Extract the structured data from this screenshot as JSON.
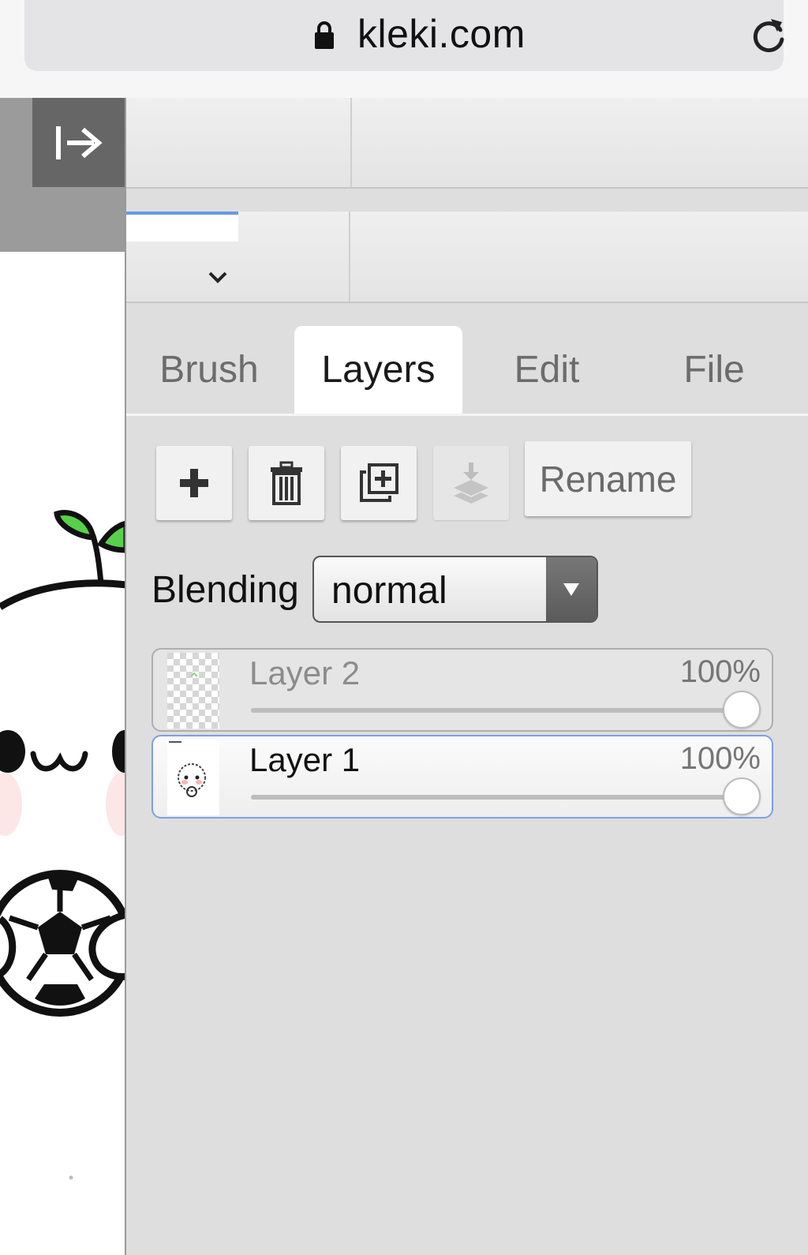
{
  "browser": {
    "url": "kleki.com",
    "lock_icon": "lock-icon",
    "reload_icon": "reload-icon"
  },
  "canvas": {
    "collapse_icon": "collapse-panel-icon"
  },
  "toolbar": {
    "chevron_icon": "chevron-down-icon",
    "accent_color": "#6a97e6"
  },
  "tabs": [
    {
      "label": "Brush",
      "active": false
    },
    {
      "label": "Layers",
      "active": true
    },
    {
      "label": "Edit",
      "active": false
    },
    {
      "label": "File",
      "active": false
    }
  ],
  "layer_tools": {
    "add_icon": "plus-icon",
    "delete_icon": "trash-icon",
    "duplicate_icon": "duplicate-icon",
    "merge_icon": "merge-down-icon",
    "rename_label": "Rename"
  },
  "blending": {
    "label": "Blending",
    "value": "normal"
  },
  "layers": [
    {
      "name": "Layer 2",
      "opacity_label": "100%",
      "opacity": 1.0,
      "selected": false
    },
    {
      "name": "Layer 1",
      "opacity_label": "100%",
      "opacity": 1.0,
      "selected": true
    }
  ]
}
